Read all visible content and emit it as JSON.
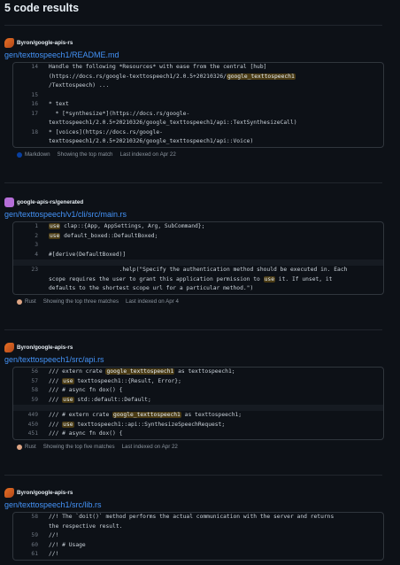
{
  "header": {
    "title": "5 code results"
  },
  "results": [
    {
      "repo": "Byron/google-apis-rs",
      "path": "gen/texttospeech1/README.md",
      "lines": [
        {
          "n": "14",
          "parts": [
            [
              "Handle the following *Resources* with ease from the central [hub]",
              false
            ]
          ]
        },
        {
          "n": "",
          "parts": [
            [
              "(https://docs.rs/google-texttospeech1/2.0.5+20210326/",
              false
            ],
            [
              "google_texttospeech1",
              true
            ]
          ]
        },
        {
          "n": "",
          "parts": [
            [
              "/Texttospeech) ...",
              false
            ]
          ]
        },
        {
          "n": "15",
          "parts": [
            [
              "",
              false
            ]
          ]
        },
        {
          "n": "16",
          "parts": [
            [
              "* text",
              false
            ]
          ]
        },
        {
          "n": "17",
          "parts": [
            [
              "  * [*synthesize*](https://docs.rs/google-",
              false
            ]
          ]
        },
        {
          "n": "",
          "parts": [
            [
              "texttospeech1/2.0.5+20210326/google_texttospeech1/api::TextSynthesizeCall)",
              false
            ]
          ]
        },
        {
          "n": "18",
          "parts": [
            [
              "* [voices](https://docs.rs/google-",
              false
            ]
          ]
        },
        {
          "n": "",
          "parts": [
            [
              "texttospeech1/2.0.5+20210326/google_texttospeech1/api::Voice)",
              false
            ]
          ]
        }
      ],
      "language": "Markdown",
      "lang_color": "#083fa1",
      "match_info": "Showing the top match",
      "indexed": "Last indexed on Apr 22"
    },
    {
      "repo": "google-apis-rs/generated",
      "path": "gen/texttospeech/v1/cli/src/main.rs",
      "lines": [
        {
          "n": "1",
          "parts": [
            [
              "use",
              true
            ],
            [
              " clap::{App, AppSettings, Arg, SubCommand};",
              false
            ]
          ]
        },
        {
          "n": "2",
          "parts": [
            [
              "use",
              true
            ],
            [
              " default_boxed::DefaultBoxed;",
              false
            ]
          ]
        },
        {
          "n": "3",
          "parts": [
            [
              "",
              false
            ]
          ]
        },
        {
          "n": "4",
          "parts": [
            [
              "#[derive(DefaultBoxed)]",
              false
            ]
          ]
        },
        {
          "gap": true
        },
        {
          "n": "23",
          "parts": [
            [
              "                     .help(\"Specify the authentication method should be executed in. Each",
              false
            ]
          ]
        },
        {
          "n": "",
          "parts": [
            [
              "scope requires the user to grant this application permission to ",
              false
            ],
            [
              "use",
              true
            ],
            [
              " it. If unset, it",
              false
            ]
          ]
        },
        {
          "n": "",
          "parts": [
            [
              "defaults to the shortest scope url for a particular method.\")",
              false
            ]
          ]
        }
      ],
      "language": "Rust",
      "lang_color": "#dea584",
      "match_info": "Showing the top three matches",
      "indexed": "Last indexed on Apr 4"
    },
    {
      "repo": "Byron/google-apis-rs",
      "path": "gen/texttospeech1/src/api.rs",
      "lines": [
        {
          "n": "56",
          "parts": [
            [
              "/// extern crate ",
              false
            ],
            [
              "google_texttospeech1",
              true
            ],
            [
              " as texttospeech1;",
              false
            ]
          ]
        },
        {
          "n": "57",
          "parts": [
            [
              "/// ",
              false
            ],
            [
              "use",
              true
            ],
            [
              " texttospeech1::{Result, Error};",
              false
            ]
          ]
        },
        {
          "n": "58",
          "parts": [
            [
              "/// # async fn dox() {",
              false
            ]
          ]
        },
        {
          "n": "59",
          "parts": [
            [
              "/// ",
              false
            ],
            [
              "use",
              true
            ],
            [
              " std::default::Default;",
              false
            ]
          ]
        },
        {
          "gap": true
        },
        {
          "n": "449",
          "parts": [
            [
              "/// # extern crate ",
              false
            ],
            [
              "google_texttospeech1",
              true
            ],
            [
              " as texttospeech1;",
              false
            ]
          ]
        },
        {
          "n": "450",
          "parts": [
            [
              "/// ",
              false
            ],
            [
              "use",
              true
            ],
            [
              " texttospeech1::api::SynthesizeSpeechRequest;",
              false
            ]
          ]
        },
        {
          "n": "451",
          "parts": [
            [
              "/// # async fn dox() {",
              false
            ]
          ]
        }
      ],
      "language": "Rust",
      "lang_color": "#dea584",
      "match_info": "Showing the top five matches",
      "indexed": "Last indexed on Apr 22"
    },
    {
      "repo": "Byron/google-apis-rs",
      "path": "gen/texttospeech1/src/lib.rs",
      "lines": [
        {
          "n": "58",
          "parts": [
            [
              "//! The `doit()` method performs the actual communication with the server and returns",
              false
            ]
          ]
        },
        {
          "n": "",
          "parts": [
            [
              "the respective result.",
              false
            ]
          ]
        },
        {
          "n": "59",
          "parts": [
            [
              "//!",
              false
            ]
          ]
        },
        {
          "n": "60",
          "parts": [
            [
              "//! # Usage",
              false
            ]
          ]
        },
        {
          "n": "61",
          "parts": [
            [
              "//!",
              false
            ]
          ]
        }
      ],
      "language": "",
      "lang_color": "",
      "match_info": "",
      "indexed": ""
    }
  ],
  "avatars": [
    "orange",
    "purple",
    "orange",
    "orange"
  ]
}
